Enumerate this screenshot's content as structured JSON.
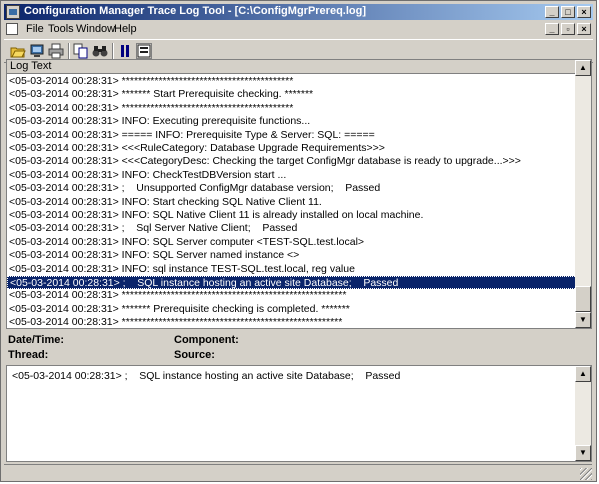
{
  "window": {
    "title": "Configuration Manager Trace Log Tool - [C:\\ConfigMgrPrereq.log]"
  },
  "menu": {
    "items": [
      "File",
      "Tools",
      "Window",
      "Help"
    ]
  },
  "toolbar": {
    "icons": [
      "open-icon",
      "open-remote-icon",
      "print-icon",
      "copy-icon",
      "find-icon",
      "pause-icon",
      "highlight-icon"
    ]
  },
  "log": {
    "column_header": "Log Text",
    "selected_index": 19,
    "lines": [
      "<05-03-2014 00:28:31> ******************************************",
      "<05-03-2014 00:28:31> ******* Start Prerequisite checking. *******",
      "<05-03-2014 00:28:31> ******************************************",
      "<05-03-2014 00:28:31> INFO: Executing prerequisite functions...",
      "<05-03-2014 00:28:31> ===== INFO: Prerequisite Type & Server: SQL: =====",
      "<05-03-2014 00:28:31> <<<RuleCategory: Database Upgrade Requirements>>>",
      "<05-03-2014 00:28:31> <<<CategoryDesc: Checking the target ConfigMgr database is ready to upgrade...>>>",
      "<05-03-2014 00:28:31> INFO: CheckTestDBVersion start ...",
      "<05-03-2014 00:28:31> ;    Unsupported ConfigMgr database version;    Passed",
      "<05-03-2014 00:28:31> INFO: Start checking SQL Native Client 11.",
      "<05-03-2014 00:28:31> INFO: SQL Native Client 11 is already installed on local machine.",
      "<05-03-2014 00:28:31> ;    Sql Server Native Client;    Passed",
      "<05-03-2014 00:28:31> INFO: SQL Server computer <TEST-SQL.test.local>",
      "<05-03-2014 00:28:31> INFO: SQL Server named instance <>",
      "<05-03-2014 00:28:31> INFO: sql instance TEST-SQL.test.local, reg value",
      "<05-03-2014 00:28:31> ;    SQL instance hosting an active site Database;    Passed",
      "<05-03-2014 00:28:31> *******************************************************",
      "<05-03-2014 00:28:31> ******* Prerequisite checking is completed. *******",
      "<05-03-2014 00:28:31> ******************************************************"
    ]
  },
  "details": {
    "datetime_label": "Date/Time:",
    "component_label": "Component:",
    "thread_label": "Thread:",
    "source_label": "Source:",
    "message": "<05-03-2014 00:28:31> ;    SQL instance hosting an active site Database;    Passed"
  }
}
